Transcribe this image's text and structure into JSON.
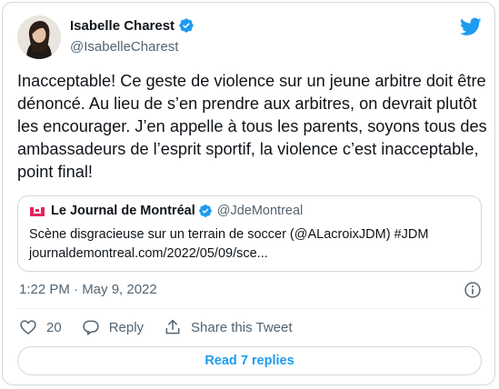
{
  "author": {
    "name": "Isabelle Charest",
    "handle": "@IsabelleCharest"
  },
  "tweet": {
    "text": "Inacceptable! Ce geste de violence sur un jeune arbitre doit être dénoncé. Au lieu de s’en prendre aux arbitres, on devrait plutôt les encourager. J’en appelle à tous les parents, soyons tous des ambassadeurs de l’esprit sportif, la violence c’est inacceptable, point final!",
    "timestamp": "1:22 PM · May 9, 2022"
  },
  "quoted": {
    "name": "Le Journal de Montréal",
    "handle": "@JdeMontreal",
    "line1": "Scène disgracieuse sur un terrain de soccer (@ALacroixJDM) #JDM",
    "line2": "journaldemontreal.com/2022/05/09/sce..."
  },
  "actions": {
    "like_count": "20",
    "reply_label": "Reply",
    "share_label": "Share this Tweet"
  },
  "read_replies_label": "Read 7 replies",
  "colors": {
    "accent": "#1d9bf0",
    "secondary_text": "#536471",
    "border": "#cfd9de",
    "quote_logo": "#e0245e"
  },
  "icons": [
    "verified-badge-icon",
    "twitter-bird-icon",
    "info-icon",
    "heart-icon",
    "reply-icon",
    "share-icon",
    "journal-logo-icon"
  ]
}
